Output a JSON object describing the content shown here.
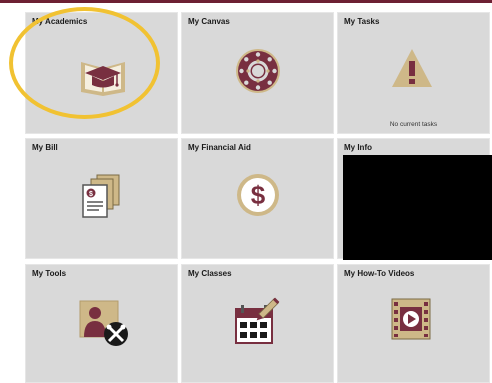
{
  "tiles": [
    {
      "label": "My Academics",
      "icon": "graduation-cap-icon"
    },
    {
      "label": "My Canvas",
      "icon": "canvas-logo-icon"
    },
    {
      "label": "My Tasks",
      "icon": "warning-icon",
      "note": "No current tasks"
    },
    {
      "label": "My Bill",
      "icon": "bill-documents-icon"
    },
    {
      "label": "My Financial Aid",
      "icon": "dollar-coin-icon"
    },
    {
      "label": "My Info",
      "icon": "",
      "redacted": true
    },
    {
      "label": "My Tools",
      "icon": "user-tools-icon"
    },
    {
      "label": "My Classes",
      "icon": "calendar-pencil-icon"
    },
    {
      "label": "My How-To Videos",
      "icon": "video-play-icon"
    }
  ],
  "colors": {
    "brand_maroon": "#782f40",
    "brand_gold": "#ceb888",
    "highlight_yellow": "#f1c232",
    "tile_bg": "#d9d9d9"
  }
}
